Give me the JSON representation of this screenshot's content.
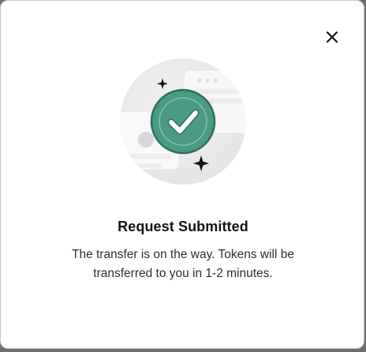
{
  "dialog": {
    "title": "Request Submitted",
    "message": "The transfer is on the way. Tokens will be transferred to you in 1-2 minutes."
  },
  "icons": {
    "close": "close-icon",
    "success": "check-circle-icon",
    "sparkle": "sparkle-icon"
  },
  "colors": {
    "success_fill": "#4a9a84",
    "success_border": "#2f6f60",
    "check": "#ffffff",
    "title": "#111318",
    "text": "#2b2e36"
  }
}
